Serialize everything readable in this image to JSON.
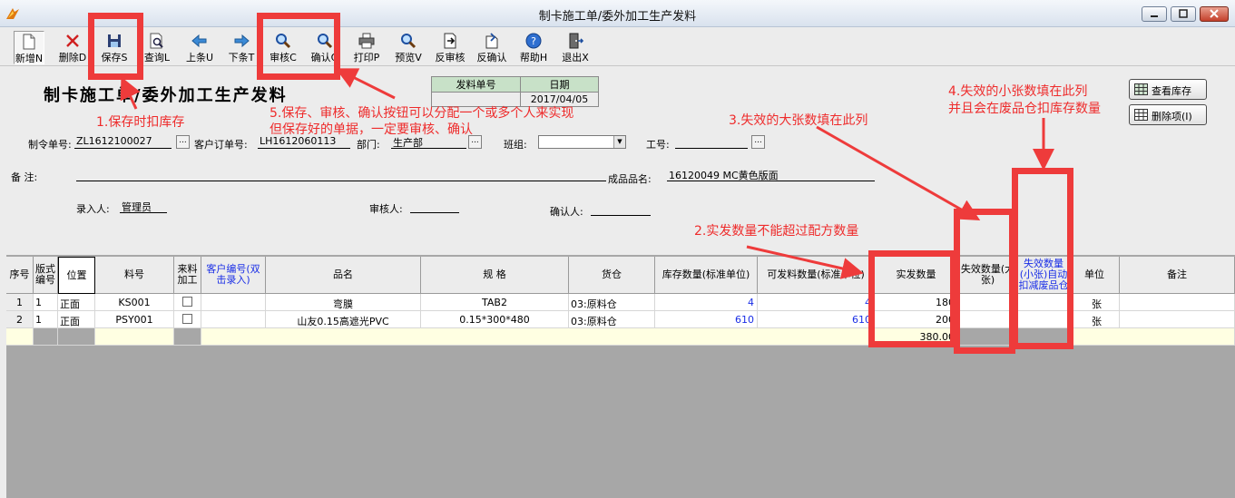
{
  "window": {
    "title": "制卡施工单/委外加工生产发料"
  },
  "toolbar": {
    "buttons": [
      {
        "label": "新增N",
        "icon": "new-doc-icon"
      },
      {
        "label": "删除D",
        "icon": "delete-x-icon"
      },
      {
        "label": "保存S",
        "icon": "save-disk-icon"
      },
      {
        "label": "查询L",
        "icon": "query-icon"
      },
      {
        "label": "上条U",
        "icon": "arrow-left-icon"
      },
      {
        "label": "下条T",
        "icon": "arrow-right-icon"
      },
      {
        "label": "审核C",
        "icon": "magnifier-icon"
      },
      {
        "label": "确认Q",
        "icon": "magnifier-icon"
      },
      {
        "label": "打印P",
        "icon": "printer-icon"
      },
      {
        "label": "预览V",
        "icon": "magnifier-icon"
      },
      {
        "label": "反审核",
        "icon": "unaudit-icon"
      },
      {
        "label": "反确认",
        "icon": "unconfirm-icon"
      },
      {
        "label": "帮助H",
        "icon": "help-icon"
      },
      {
        "label": "退出X",
        "icon": "exit-door-icon"
      }
    ]
  },
  "form": {
    "title": "制卡施工单/委外加工生产发料",
    "doc_no_label": "发料单号",
    "date_label": "日期",
    "doc_no": "",
    "date": "2017/04/05",
    "order_no_label": "制令单号:",
    "order_no": "ZL1612100027",
    "customer_order_label": "客户订单号:",
    "customer_order": "LH1612060113",
    "department_label": "部门:",
    "department": "生产部",
    "team_label": "班组:",
    "team": "",
    "worker_no_label": "工号:",
    "worker_no": "",
    "remark_label": "备    注:",
    "remark": "",
    "product_label": "成品品名:",
    "product": "16120049  MC黄色版面",
    "entry_person_label": "录入人:",
    "entry_person": "管理员",
    "auditor_label": "审核人:",
    "auditor": "",
    "confirmer_label": "确认人:",
    "confirmer": "",
    "view_stock_label": "查看库存",
    "delete_item_label": "删除项(I)"
  },
  "grid": {
    "headers": [
      "序号",
      "版式编号",
      "位置",
      "料号",
      "来料加工",
      "客户编号(双击录入)",
      "品名",
      "规    格",
      "货仓",
      "库存数量(标准单位)",
      "可发料数量(标准单位)",
      "实发数量",
      "失效数量(大张)",
      "失效数量(小张)自动扣减废品仓",
      "单位",
      "备注"
    ],
    "rows": [
      {
        "no": "1",
        "layout": "1",
        "position": "正面",
        "item_no": "KS001",
        "customer_no": "",
        "name": "弯膜",
        "spec": "TAB2",
        "warehouse": "03:原料仓",
        "stock": "4",
        "available": "4",
        "issued": "180",
        "void_large": "",
        "void_small": "",
        "unit": "张",
        "remark": ""
      },
      {
        "no": "2",
        "layout": "1",
        "position": "正面",
        "item_no": "PSY001",
        "customer_no": "",
        "name": "山友0.15高遮光PVC",
        "spec": "0.15*300*480",
        "warehouse": "03:原料仓",
        "stock": "610",
        "available": "610",
        "issued": "200",
        "void_large": "",
        "void_small": "",
        "unit": "张",
        "remark": ""
      }
    ],
    "total_issued": "380.00"
  },
  "annotations": {
    "note1": "1.保存时扣库存",
    "note2": "2.实发数量不能超过配方数量",
    "note3": "3.失效的大张数填在此列",
    "note4_line1": "4.失效的小张数填在此列",
    "note4_line2": "并且会在废品仓扣库存数量",
    "note5_line1": "5.保存、审核、确认按钮可以分配一个或多个人来实现",
    "note5_line2": "但保存好的单据，一定要审核、确认"
  },
  "colors": {
    "annotation": "#ee3b3b",
    "header_blue": "#1a2ee6",
    "new_row": "#ffffe2"
  }
}
